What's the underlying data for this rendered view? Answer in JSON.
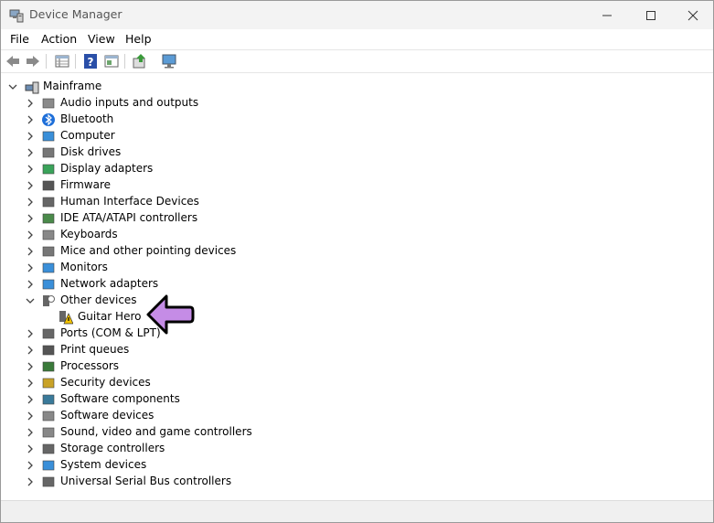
{
  "window": {
    "title": "Device Manager"
  },
  "menu": {
    "file": "File",
    "action": "Action",
    "view": "View",
    "help": "Help"
  },
  "toolbar": {
    "icons": [
      "back-arrow-icon",
      "forward-arrow-icon",
      "properties-grid-icon",
      "help-question-icon",
      "show-hidden-icon",
      "scan-hardware-icon",
      "monitor-network-icon"
    ]
  },
  "tree": {
    "root": "Mainframe",
    "categories": [
      {
        "label": "Audio inputs and outputs",
        "icon": "speaker-icon"
      },
      {
        "label": "Bluetooth",
        "icon": "bluetooth-icon"
      },
      {
        "label": "Computer",
        "icon": "computer-monitor-icon"
      },
      {
        "label": "Disk drives",
        "icon": "disk-drive-icon"
      },
      {
        "label": "Display adapters",
        "icon": "display-adapter-icon"
      },
      {
        "label": "Firmware",
        "icon": "firmware-chip-icon"
      },
      {
        "label": "Human Interface Devices",
        "icon": "hid-icon"
      },
      {
        "label": "IDE ATA/ATAPI controllers",
        "icon": "ide-controller-icon"
      },
      {
        "label": "Keyboards",
        "icon": "keyboard-icon"
      },
      {
        "label": "Mice and other pointing devices",
        "icon": "mouse-icon"
      },
      {
        "label": "Monitors",
        "icon": "monitor-icon"
      },
      {
        "label": "Network adapters",
        "icon": "network-adapter-icon"
      },
      {
        "label": "Other devices",
        "icon": "unknown-device-icon",
        "expanded": true
      },
      {
        "label": "Ports (COM & LPT)",
        "icon": "port-icon"
      },
      {
        "label": "Print queues",
        "icon": "printer-icon"
      },
      {
        "label": "Processors",
        "icon": "processor-icon"
      },
      {
        "label": "Security devices",
        "icon": "security-key-icon"
      },
      {
        "label": "Software components",
        "icon": "software-component-icon"
      },
      {
        "label": "Software devices",
        "icon": "software-device-icon"
      },
      {
        "label": "Sound, video and game controllers",
        "icon": "sound-controller-icon"
      },
      {
        "label": "Storage controllers",
        "icon": "storage-controller-icon"
      },
      {
        "label": "System devices",
        "icon": "system-device-icon"
      },
      {
        "label": "Universal Serial Bus controllers",
        "icon": "usb-icon"
      }
    ],
    "other_devices_children": [
      {
        "label": "Guitar Hero",
        "icon": "warning-device-icon"
      }
    ]
  },
  "colors": {
    "annotation_arrow": "#c58ce6",
    "titlebar": "#f3f3f3"
  }
}
